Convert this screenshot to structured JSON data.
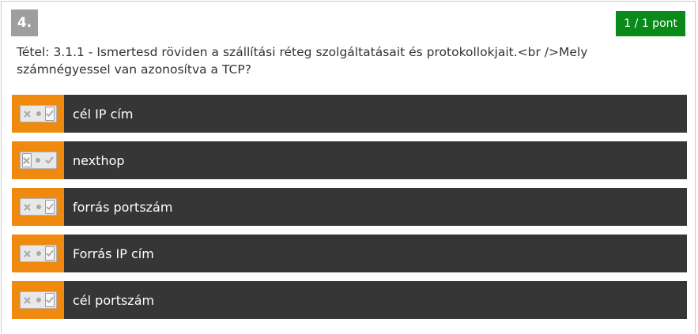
{
  "question": {
    "number": "4.",
    "score": "1 / 1 pont",
    "text": "Tétel: 3.1.1 - Ismertesd röviden a szállítási réteg szolgáltatásait és protokollokjait.<br />Mely számnégyessel van azonosítva a TCP?"
  },
  "answers": [
    {
      "label": "cél IP cím",
      "state": "checked"
    },
    {
      "label": "nexthop",
      "state": "crossed"
    },
    {
      "label": "forrás portszám",
      "state": "checked"
    },
    {
      "label": "Forrás IP cím",
      "state": "checked"
    },
    {
      "label": "cél portszám",
      "state": "checked"
    }
  ],
  "icons": {
    "toggle_cross": "x-icon",
    "toggle_neutral": "dot-icon",
    "toggle_check": "check-icon"
  },
  "colors": {
    "answer_accent": "#ef8a0f",
    "answer_bg": "#363636",
    "score_badge": "#0b8a1c",
    "number_badge": "#9e9e9e"
  }
}
